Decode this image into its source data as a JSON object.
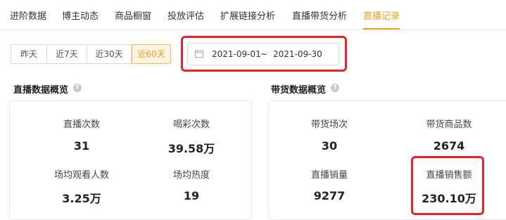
{
  "tabs": [
    {
      "label": "进阶数据",
      "active": false
    },
    {
      "label": "博主动态",
      "active": false
    },
    {
      "label": "商品橱窗",
      "active": false
    },
    {
      "label": "投放评估",
      "active": false
    },
    {
      "label": "扩展链接分析",
      "active": false
    },
    {
      "label": "直播带货分析",
      "active": false
    },
    {
      "label": "直播记录",
      "active": true
    }
  ],
  "ranges": [
    {
      "label": "昨天",
      "active": false
    },
    {
      "label": "近7天",
      "active": false
    },
    {
      "label": "近30天",
      "active": false
    },
    {
      "label": "近60天",
      "active": true
    }
  ],
  "date_range": {
    "start": "2021-09-01",
    "separator": "~",
    "end": "2021-09-30",
    "icon": "calendar-icon"
  },
  "live_overview": {
    "title": "直播数据概览",
    "help_icon": "question-icon",
    "metrics": [
      {
        "label": "直播次数",
        "value": "31"
      },
      {
        "label": "喝彩次数",
        "value": "39.58万"
      },
      {
        "label": "场均观看人数",
        "value": "3.25万"
      },
      {
        "label": "场均热度",
        "value": "19"
      }
    ]
  },
  "sales_overview": {
    "title": "带货数据概览",
    "help_icon": "question-icon",
    "metrics": [
      {
        "label": "带货场次",
        "value": "30"
      },
      {
        "label": "带货商品数",
        "value": "2674"
      },
      {
        "label": "直播销量",
        "value": "9277"
      },
      {
        "label": "直播销售额",
        "value": "230.10万"
      }
    ]
  },
  "colors": {
    "accent": "#f0a018",
    "highlight": "#e8242a",
    "active_bg": "#fff4e2"
  }
}
